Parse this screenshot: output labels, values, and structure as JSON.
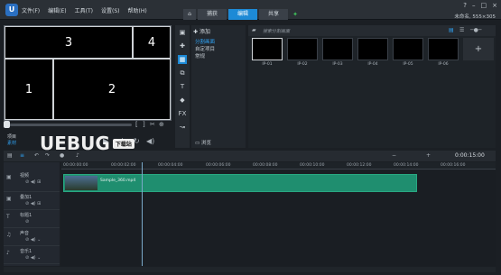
{
  "app": {
    "title_menu": [
      "文件(F)",
      "编辑(E)",
      "工具(T)",
      "设置(S)",
      "帮助(H)"
    ],
    "tabs": [
      "捕获",
      "编辑",
      "共享"
    ],
    "active_tab": "编辑",
    "project_title": "未命名, 555×305"
  },
  "preview": {
    "cells": [
      "3",
      "4",
      "1",
      "2"
    ],
    "project_label": "项目",
    "clip_label": "素材"
  },
  "watermark": {
    "text": "UEBUG",
    "badge": "下载站"
  },
  "library": {
    "add_label": "添加",
    "categories": [
      "分割画面",
      "自定项目",
      "常规"
    ],
    "selected_category": "分割画面",
    "browse_label": "浏览",
    "search_placeholder": "搜索分割画面",
    "thumbnails": [
      "IP-01",
      "IP-02",
      "IP-03",
      "IP-04",
      "IP-05",
      "IP-06"
    ],
    "add_thumb": "+"
  },
  "timeline": {
    "ruler": [
      "00:00:00:00",
      "00:00:02:00",
      "00:00:04:00",
      "00:00:06:00",
      "00:00:08:00",
      "00:00:10:00",
      "00:00:12:00",
      "00:00:14:00",
      "00:00:16:00"
    ],
    "timecode": "0:00:15:00",
    "tracks": [
      "视频",
      "叠加1",
      "标题1",
      "声音",
      "音乐1"
    ],
    "clip_label": "Sample_360.mp4"
  },
  "colors": {
    "accent": "#1d8ad6",
    "clip": "#1f8e6f"
  }
}
